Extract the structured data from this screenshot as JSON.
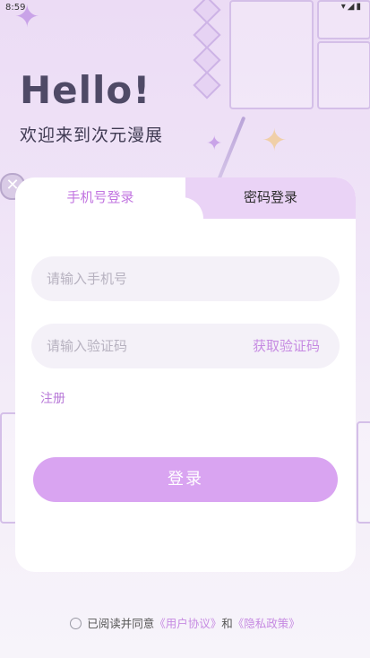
{
  "status_bar": {
    "time": "8:59",
    "icons": "▾◢▮"
  },
  "header": {
    "greeting": "Hello!",
    "subtitle": "欢迎来到次元漫展"
  },
  "tabs": [
    {
      "label": "手机号登录",
      "active": true
    },
    {
      "label": "密码登录",
      "active": false
    }
  ],
  "form": {
    "phone_placeholder": "请输入手机号",
    "code_placeholder": "请输入验证码",
    "get_code_label": "获取验证码",
    "register_label": "注册",
    "login_label": "登录"
  },
  "agreement": {
    "prefix": "已阅读并同意",
    "user_agreement": "《用户协议》",
    "and": "和",
    "privacy_policy": "《隐私政策》"
  },
  "colors": {
    "accent": "#c68ae2",
    "button": "#d9a4f1",
    "tab_bg": "#ead3f6"
  }
}
